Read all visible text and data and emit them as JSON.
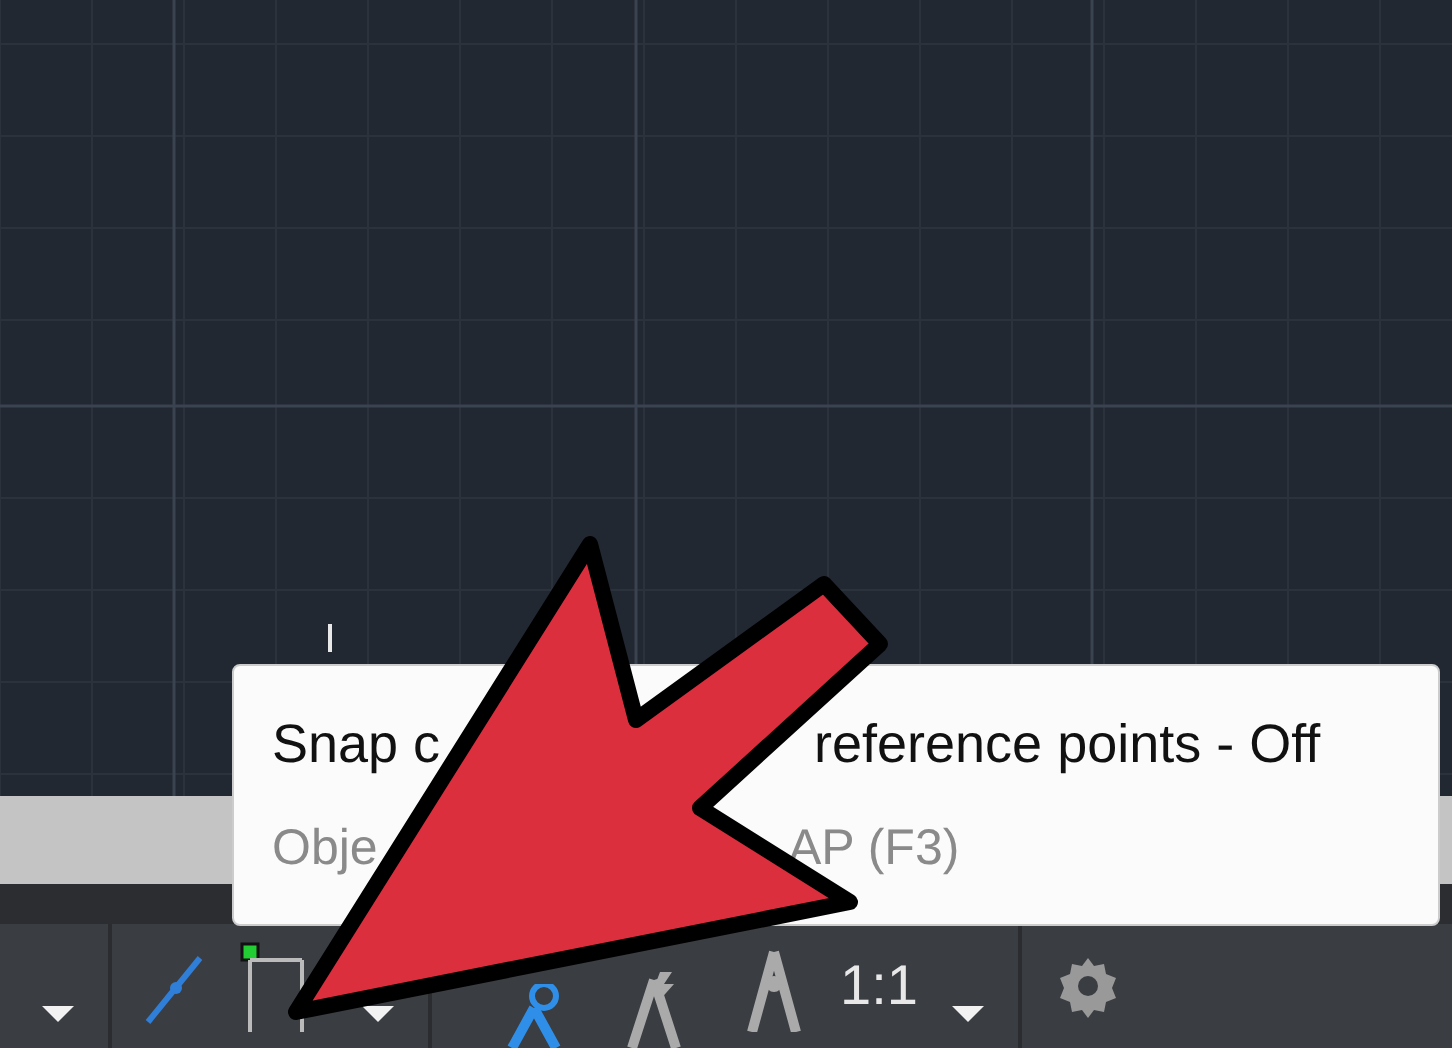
{
  "tooltip": {
    "title_parts": [
      "Snap c",
      "reference points - Off"
    ],
    "subtitle_parts": [
      "Obje",
      "AP (F3)"
    ]
  },
  "status_bar": {
    "scale": "1:1"
  }
}
